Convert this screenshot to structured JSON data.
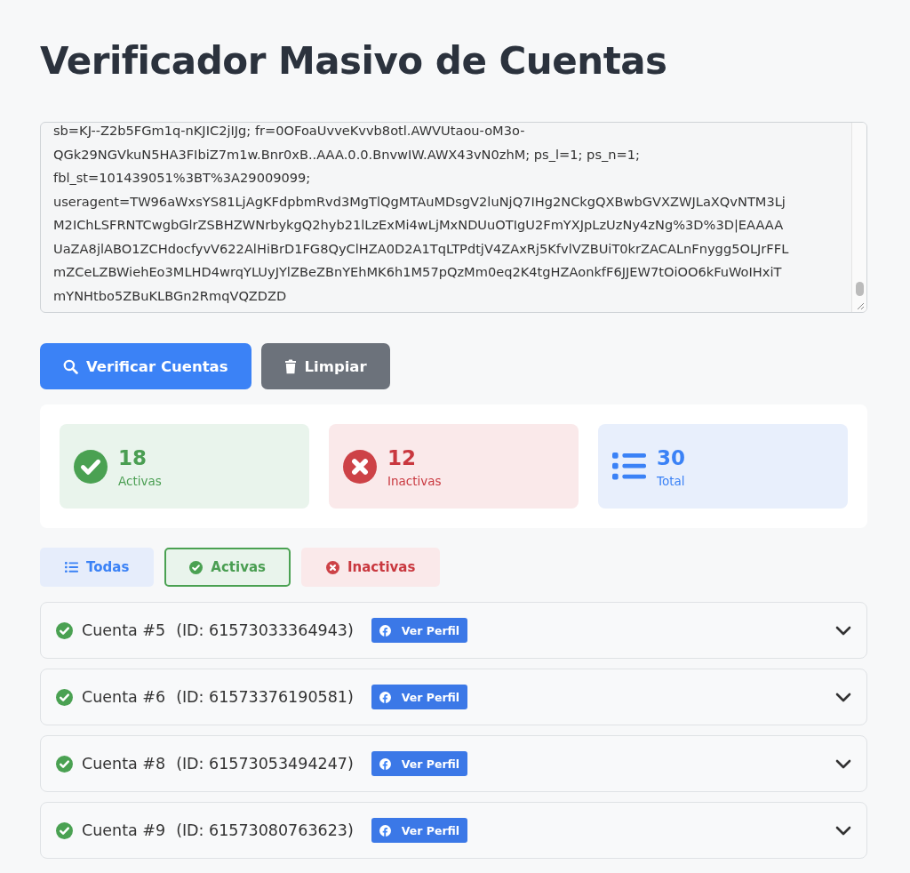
{
  "title": "Verificador Masivo de Cuentas",
  "cookie_input": {
    "value_lines": [
      "sb=KJ--Z2b5FGm1q-nKJIC2jIJg; fr=0OFoaUvveKvvb8otl.AWVUtaou-oM3o-",
      "QGk29NGVkuN5HA3FIbiZ7m1w.Bnr0xB..AAA.0.0.BnvwIW.AWX43vN0zhM; ps_l=1; ps_n=1;",
      "fbl_st=101439051%3BT%3A29009099;",
      "useragent=TW96aWxsYS81LjAgKFdpbmRvd3MgTlQgMTAuMDsgV2luNjQ7IHg2NCkgQXBwbGVXZWJLaXQvNTM3Lj",
      "M2IChLSFRNTCwgbGlrZSBHZWNrbykgQ2hyb21lLzExMi4wLjMxNDUuOTIgU2FmYXJpLzUzNy4zNg%3D%3D|EAAAA",
      "UaZA8jlABO1ZCHdocfyvV622AlHiBrD1FG8QyClHZA0D2A1TqLTPdtjV4ZAxRj5KfvlVZBUiT0krZACALnFnygg5OLJrFFL",
      "mZCeLZBWiehEo3MLHD4wrqYLUyJYlZBeZBnYEhMK6h1M57pQzMm0eq2K4tgHZAonkfF6JJEW7tOiOO6kFuWoIHxiT",
      "mYNHtbo5ZBuKLBGn2RmqVQZDZD"
    ]
  },
  "actions": [
    {
      "kind": "primary",
      "label": "Verificar Cuentas"
    },
    {
      "kind": "secondary",
      "label": "Limpiar"
    }
  ],
  "stats": [
    {
      "kind": "success",
      "count": "18",
      "label": "Activas"
    },
    {
      "kind": "danger",
      "count": "12",
      "label": "Inactivas"
    },
    {
      "kind": "info",
      "count": "30",
      "label": "Total"
    }
  ],
  "filters": [
    {
      "kind": "all",
      "label": "Todas",
      "selected": false
    },
    {
      "kind": "active",
      "label": "Activas",
      "selected": true
    },
    {
      "kind": "inactive",
      "label": "Inactivas",
      "selected": false
    }
  ],
  "accounts": [
    {
      "active": true,
      "name": "Cuenta #5",
      "id": "(ID: 61573033364943)",
      "button": "Ver Perfil",
      "expanded": false
    },
    {
      "active": true,
      "name": "Cuenta #6",
      "id": "(ID: 61573376190581)",
      "button": "Ver Perfil",
      "expanded": false
    },
    {
      "active": true,
      "name": "Cuenta #8",
      "id": "(ID: 61573053494247)",
      "button": "Ver Perfil",
      "expanded": false
    },
    {
      "active": true,
      "name": "Cuenta #9",
      "id": "(ID: 61573080763623)",
      "button": "Ver Perfil",
      "expanded": false
    }
  ]
}
